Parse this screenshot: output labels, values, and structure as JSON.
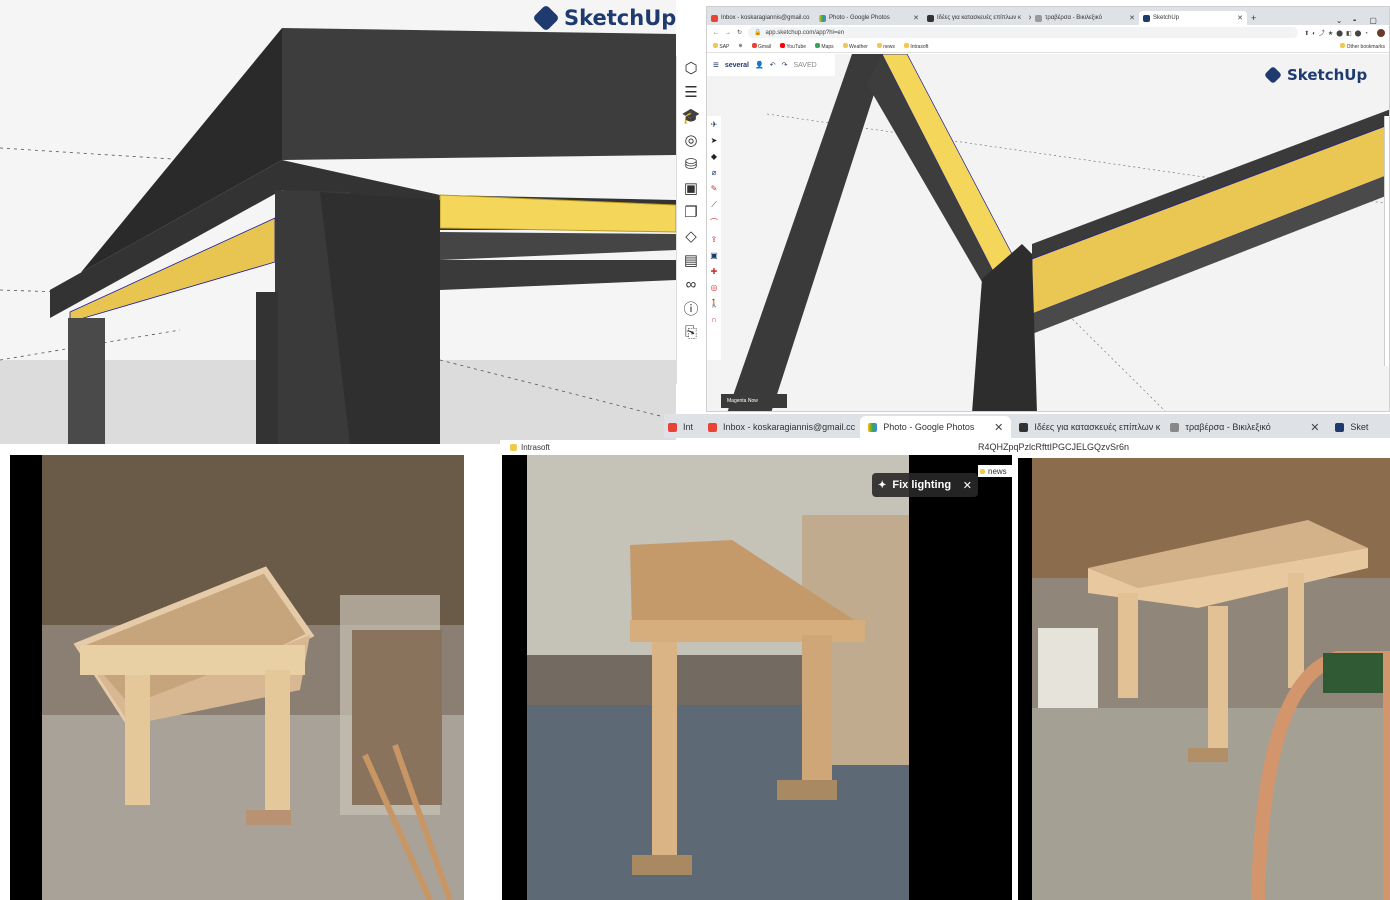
{
  "logo_text": "SketchUp",
  "left_toolbar_icons": [
    "layers-icon",
    "outliner-icon",
    "instructor-icon",
    "materials-icon",
    "components-icon",
    "styles-icon",
    "scenes-icon",
    "eraser-icon",
    "film-icon",
    "glasses-icon",
    "info-icon",
    "export-icon"
  ],
  "browser1": {
    "tabs": [
      {
        "label": "Inbox - koskaragiannis@gmail.co",
        "icon": "gmail-icon"
      },
      {
        "label": "Photo - Google Photos",
        "icon": "photos-icon"
      },
      {
        "label": "Ιδέες για κατασκευές επίπλων κ",
        "icon": "av-icon"
      },
      {
        "label": "τραβέρσα - Βικιλεξικό",
        "icon": "wiki-icon"
      },
      {
        "label": "SketchUp",
        "icon": "sketchup-icon"
      }
    ],
    "new_tab": "+",
    "url": "app.sketchup.com/app?hl=en",
    "bookmarks": [
      "SAP",
      "",
      "Gmail",
      "YouTube",
      "Maps",
      "Weather",
      "news",
      "Intrasoft"
    ],
    "other_bookmarks": "Other bookmarks",
    "app_toolbar": {
      "menu": "≡",
      "model_name": "several",
      "status": "SAVED"
    },
    "bottom_label": "Magenta Now"
  },
  "browser2": {
    "tabs": [
      {
        "label": "Int",
        "icon": "gmail-icon"
      },
      {
        "label": "Inbox - koskaragiannis@gmail.cc",
        "icon": "gmail-icon"
      },
      {
        "label": "Photo - Google Photos",
        "icon": "photos-icon"
      },
      {
        "label": "Ιδέες για κατασκευές επίπλων κ",
        "icon": "av-icon"
      },
      {
        "label": "τραβέρσα - Βικιλεξικό",
        "icon": "wiki-icon"
      },
      {
        "label": "Sket",
        "icon": "sketchup-icon"
      }
    ],
    "url_fragment": "R4QHZpqPzlcRfttIPGCJELGQzvSr6n",
    "bookmark_intrasoft": "Intrasoft",
    "bookmark_news": "news",
    "fix_lighting": "Fix lighting"
  },
  "colors": {
    "dark_wood": "#3b3b3b",
    "yellow": "#f5d858",
    "accent": "#1e3a6e"
  }
}
